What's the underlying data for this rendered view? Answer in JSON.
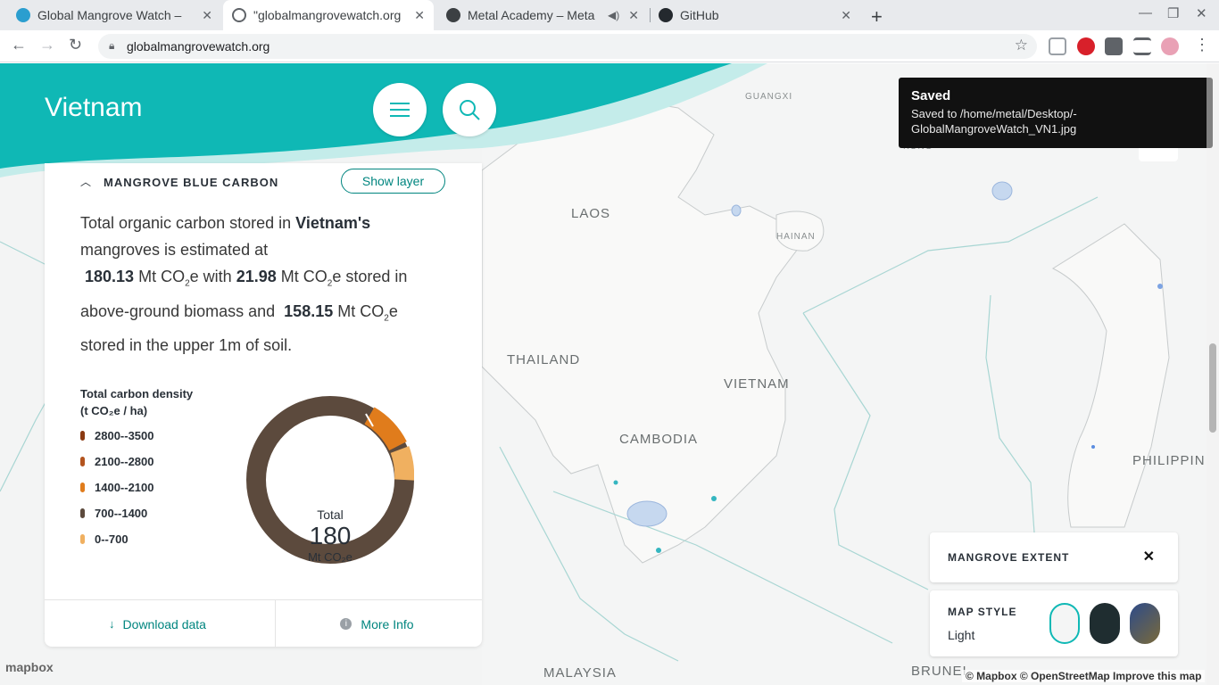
{
  "browser": {
    "tabs": [
      {
        "title": "Global Mangrove Watch –",
        "active": false
      },
      {
        "title": "\"globalmangrovewatch.org",
        "active": true
      },
      {
        "title": "Metal Academy – Meta",
        "active": false
      },
      {
        "title": "GitHub",
        "active": false
      }
    ],
    "url": "globalmangrovewatch.org"
  },
  "header": {
    "title": "Vietnam"
  },
  "panel": {
    "section_title": "MANGROVE BLUE CARBON",
    "show_layer_label": "Show layer",
    "summary": {
      "p1": "Total organic carbon stored in ",
      "country": "Vietnam's",
      "p2": " mangroves is estimated at ",
      "total": "180.13",
      "unit": "Mt CO",
      "sub": "2",
      "unit_e": "e",
      "with": " with ",
      "above": "21.98",
      "stored_in": " stored in above-ground biomass and ",
      "soil": "158.15",
      "end": " stored in the upper 1m of soil."
    },
    "legend": {
      "title_line1": "Total carbon density",
      "title_line2": "(t CO₂e / ha)",
      "items": [
        {
          "label": "2800--3500",
          "color": "#8a3a12"
        },
        {
          "label": "2100--2800",
          "color": "#b3541e"
        },
        {
          "label": "1400--2100",
          "color": "#e07c1c"
        },
        {
          "label": "700--1400",
          "color": "#5c4a3d"
        },
        {
          "label": "0--700",
          "color": "#f0b060"
        }
      ]
    },
    "donut": {
      "center_title": "Total",
      "center_value": "180",
      "center_unit": "Mt CO₂e"
    },
    "footer": {
      "download_label": "Download data",
      "info_label": "More Info"
    }
  },
  "map": {
    "labels": [
      "LAOS",
      "THAILAND",
      "VIETNAM",
      "CAMBODIA",
      "PHILIPPIN",
      "MALAYSIA",
      "BRUNEI",
      "GUANGXI",
      "HAINAN",
      "KONG"
    ],
    "attribution": "© Mapbox © OpenStreetMap  Improve this map",
    "logo": "mapbox"
  },
  "toast": {
    "title": "Saved",
    "message": "Saved to /home/metal/Desktop/-GlobalMangroveWatch_VN1.jpg"
  },
  "layers_widget": {
    "extent_label": "MANGROVE EXTENT",
    "map_style_label": "MAP STYLE",
    "map_style_value": "Light"
  },
  "colors": {
    "teal": "#00857f",
    "header_teal": "#0fb8b5",
    "soil": "#5c4a3d",
    "above": "#e07c1c"
  }
}
